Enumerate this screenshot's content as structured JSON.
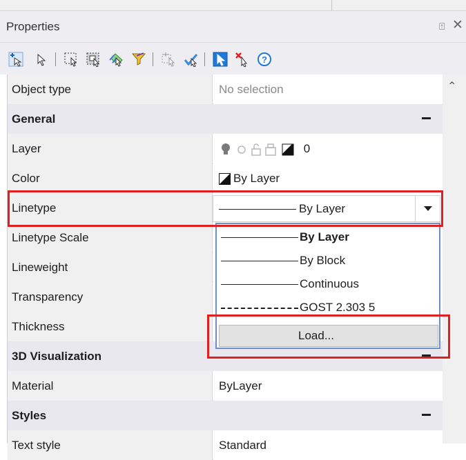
{
  "panel": {
    "title": "Properties",
    "pin_glyph": "⍐",
    "close_glyph": "✕"
  },
  "toolbar": {
    "icons": [
      "add-select-icon",
      "select-icon",
      "window-select-icon",
      "crossing-select-icon",
      "quick-select-icon",
      "filter-icon",
      "select-similar-icon",
      "match-properties-icon",
      "pickadd-toggle-icon",
      "deselect-icon",
      "help-icon"
    ]
  },
  "rows": [
    {
      "name": "Object type",
      "value": "No selection",
      "muted": true
    },
    {
      "name": "General",
      "header": true
    },
    {
      "name": "Layer",
      "value": "0"
    },
    {
      "name": "Color",
      "value": "By Layer"
    },
    {
      "name": "Linetype",
      "value": "By Layer"
    },
    {
      "name": "Linetype Scale",
      "value": ""
    },
    {
      "name": "Lineweight",
      "value": ""
    },
    {
      "name": "Transparency",
      "value": ""
    },
    {
      "name": "Thickness",
      "value": ""
    },
    {
      "name": "3D Visualization",
      "header": true
    },
    {
      "name": "Material",
      "value": "ByLayer"
    },
    {
      "name": "Styles",
      "header": true
    },
    {
      "name": "Text style",
      "value": "Standard"
    }
  ],
  "linetype_dropdown": {
    "selected": "By Layer",
    "options": [
      "By Layer",
      "By Block",
      "Continuous",
      "GOST 2.303 5"
    ],
    "load_label": "Load..."
  },
  "colors": {
    "highlight": "#e02020",
    "dropdown_border": "#6a8fd0"
  }
}
